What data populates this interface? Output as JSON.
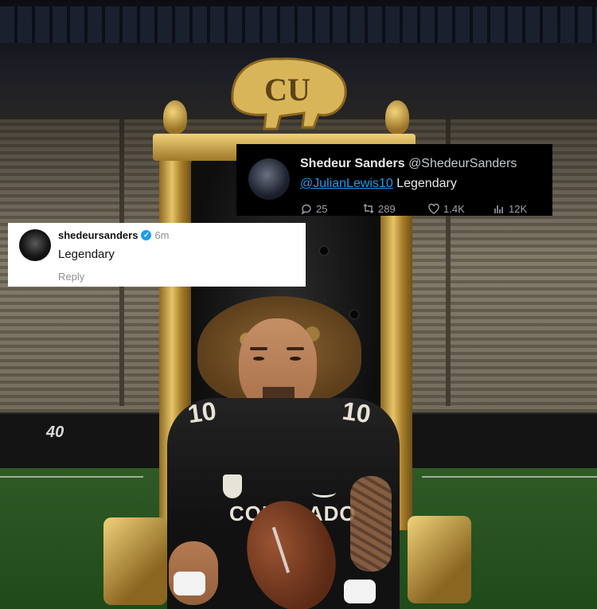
{
  "tweet": {
    "name": "Shedeur Sanders",
    "handle": "@ShedeurSanders",
    "mention": "@JulianLewis10",
    "text": "Legendary",
    "replies": "25",
    "retweets": "289",
    "likes": "1.4K",
    "views": "12K",
    "mention_color": "#1d9bf0"
  },
  "comment": {
    "username": "shedeursanders",
    "time": "6m",
    "text": "Legendary",
    "reply_label": "Reply"
  },
  "photo": {
    "jersey_number": "10",
    "jersey_text": "COLORADO",
    "wall_number": "40"
  }
}
